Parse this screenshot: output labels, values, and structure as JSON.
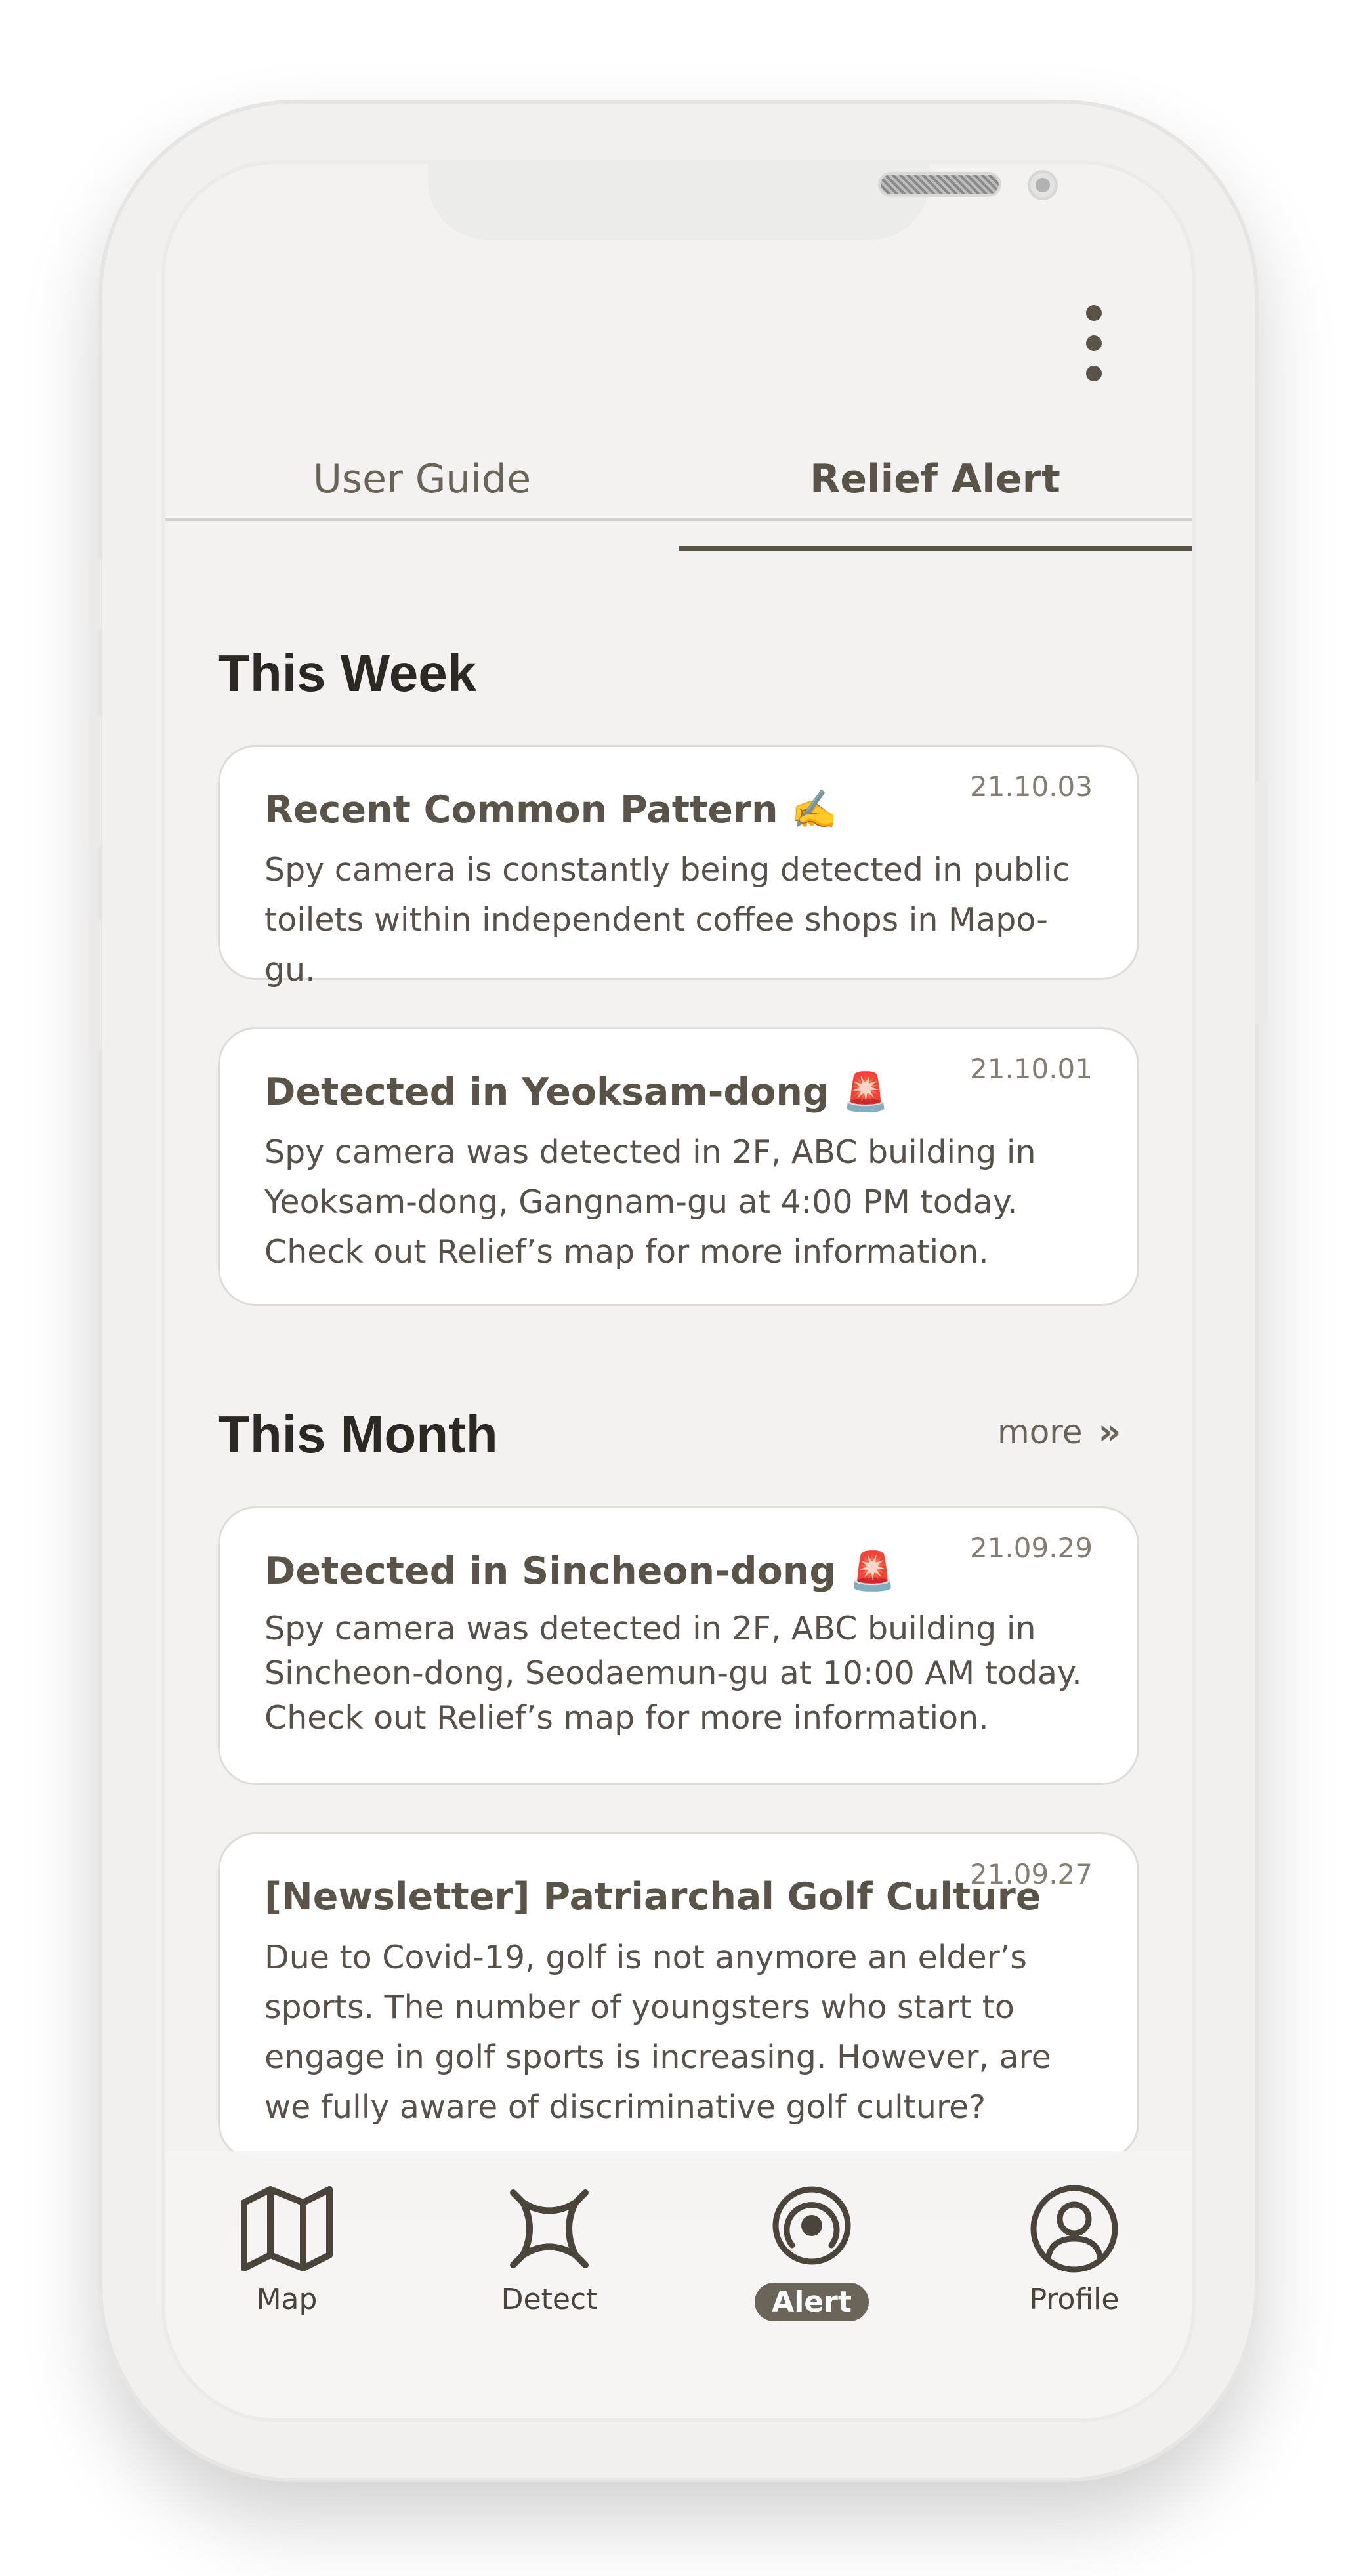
{
  "tabs": [
    {
      "label": "User Guide"
    },
    {
      "label": "Relief Alert"
    }
  ],
  "sections": {
    "this_week": "This Week",
    "this_month": "This Month",
    "more": "more"
  },
  "week_cards": [
    {
      "date": "21.10.03",
      "title": "Recent Common Pattern ✍️",
      "body": "Spy camera is constantly being detected in public toilets within independent coffee shops in Mapo-gu."
    },
    {
      "date": "21.10.01",
      "title": "Detected in Yeoksam-dong 🚨",
      "body": "Spy camera was detected in 2F, ABC building in Yeoksam-dong, Gangnam-gu at 4:00 PM today. Check out Relief’s map for more information."
    }
  ],
  "month_cards": [
    {
      "date": "21.09.29",
      "title": "Detected in Sincheon-dong 🚨",
      "body": "Spy camera was detected in 2F, ABC building in Sincheon-dong, Seodaemun-gu at 10:00 AM today. Check out Relief’s map for more information."
    },
    {
      "date": "21.09.27",
      "title": "[Newsletter] Patriarchal Golf Culture",
      "body": "Due to Covid-19, golf is not anymore an elder’s sports. The number of youngsters who start to engage in golf sports is increasing. However, are we fully aware of discriminative golf culture?"
    }
  ],
  "nav": [
    {
      "label": "Map",
      "icon": "map-icon"
    },
    {
      "label": "Detect",
      "icon": "detect-icon"
    },
    {
      "label": "Alert",
      "icon": "alert-icon",
      "active": true
    },
    {
      "label": "Profile",
      "icon": "profile-icon"
    }
  ],
  "colors": {
    "accent": "#5a5348",
    "background": "#f3f2f1",
    "card": "#ffffff"
  }
}
